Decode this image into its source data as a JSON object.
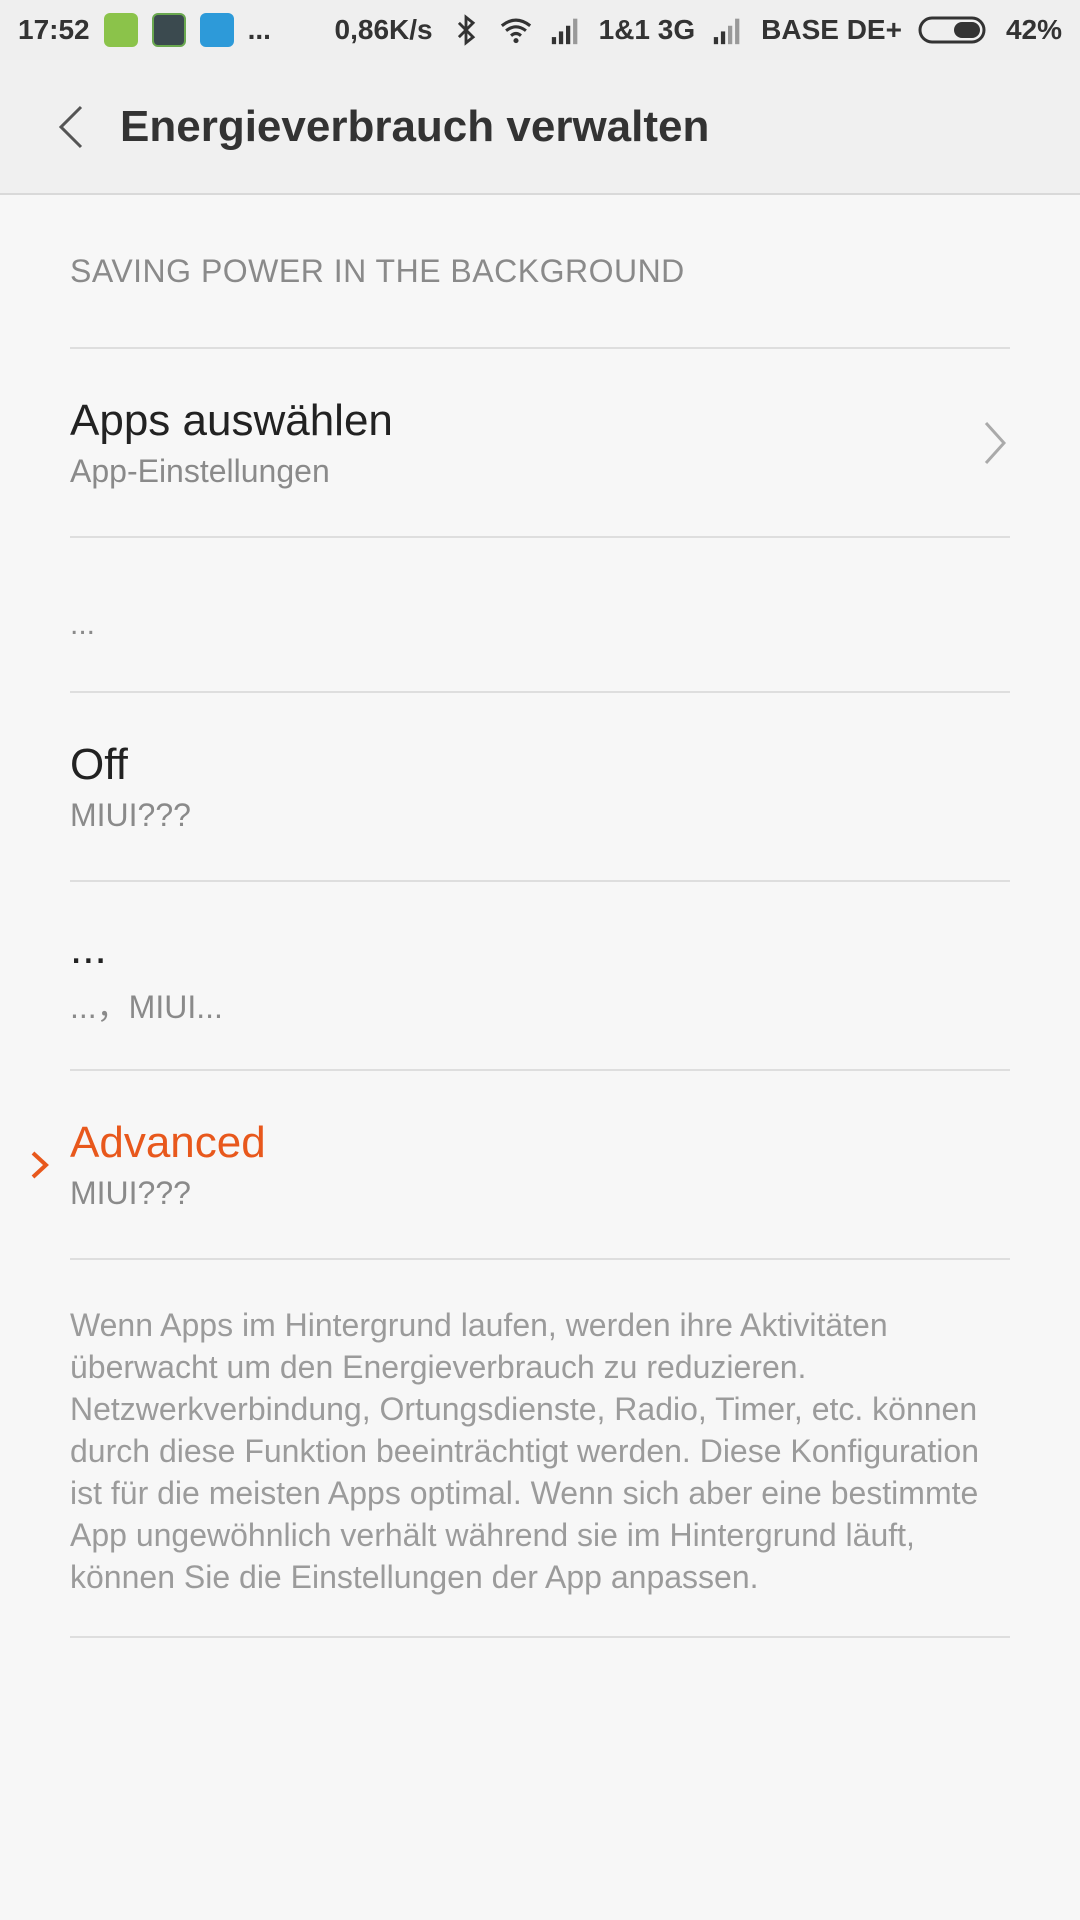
{
  "status_bar": {
    "time": "17:52",
    "more": "...",
    "net_speed": "0,86K/s",
    "carrier1": "1&1 3G",
    "carrier2": "BASE DE+",
    "battery": "42%",
    "icons": [
      "shield-app-icon",
      "app-icon",
      "app-icon",
      "bluetooth-icon",
      "wifi-icon",
      "signal-icon",
      "signal-icon",
      "battery-icon"
    ]
  },
  "header": {
    "title": "Energieverbrauch verwalten",
    "back_icon": "chevron-left-icon"
  },
  "section": {
    "title": "SAVING POWER IN THE BACKGROUND"
  },
  "rows": [
    {
      "title": "Apps auswählen",
      "subtitle": "App-Einstellungen",
      "icon": "chevron-right-icon"
    },
    {
      "spacer": "..."
    },
    {
      "title": "Off",
      "subtitle": "MIUI???"
    },
    {
      "title": "...",
      "subtitle": "...，MIUI..."
    },
    {
      "title": "Advanced",
      "subtitle": "MIUI???",
      "selected": true
    }
  ],
  "description": "Wenn Apps im Hintergrund laufen, werden ihre Aktivitäten überwacht um den Energieverbrauch zu reduzieren. Netzwerkverbindung, Ortungsdienste, Radio, Timer, etc. können durch diese Funktion beeinträchtigt werden. Diese Konfiguration ist für die meisten Apps optimal. Wenn sich aber eine bestimmte App ungewöhnlich verhält während sie im Hintergrund läuft, können Sie die Einstellungen der App anpassen.",
  "colors": {
    "accent": "#e8581c",
    "text_primary": "#222222",
    "text_secondary": "#8a8a8a",
    "divider": "#dedede"
  }
}
